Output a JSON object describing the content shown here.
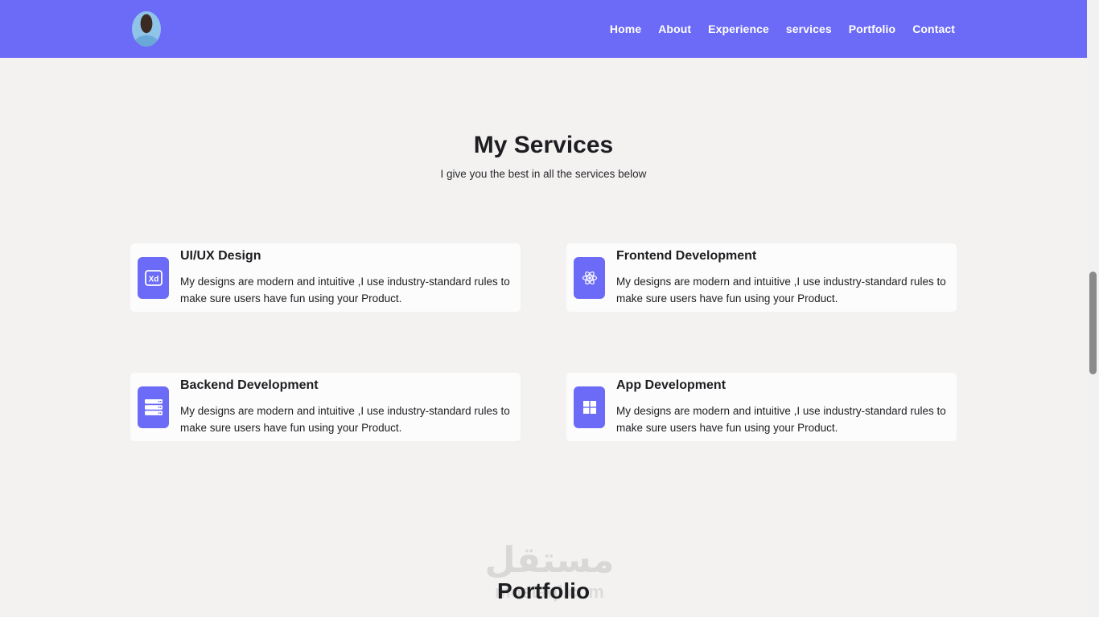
{
  "nav": {
    "links": [
      "Home",
      "About",
      "Experience",
      "services",
      "Portfolio",
      "Contact"
    ]
  },
  "services": {
    "title": "My Services",
    "subtitle": "I give you the best in all the services below",
    "items": [
      {
        "title": "UI/UX Design",
        "icon": "xd-icon",
        "text": "My designs are modern and intuitive ,I use industry-standard rules to make sure users have fun using your Product."
      },
      {
        "title": "Frontend Development",
        "icon": "react-icon",
        "text": "My designs are modern and intuitive ,I use industry-standard rules to make sure users have fun using your Product."
      },
      {
        "title": "Backend Development",
        "icon": "server-icon",
        "text": "My designs are modern and intuitive ,I use industry-standard rules to make sure users have fun using your Product."
      },
      {
        "title": "App Development",
        "icon": "windows-grid-icon",
        "text": "My designs are modern and intuitive ,I use industry-standard rules to make sure users have fun using your Product."
      }
    ]
  },
  "portfolio": {
    "title": "Portfolio"
  },
  "watermark": {
    "arabic": "مستقل",
    "latin": "mostaql.com"
  },
  "colors": {
    "accent": "#6c6bf7",
    "background": "#f3f2f1",
    "card": "#fcfcfc"
  }
}
